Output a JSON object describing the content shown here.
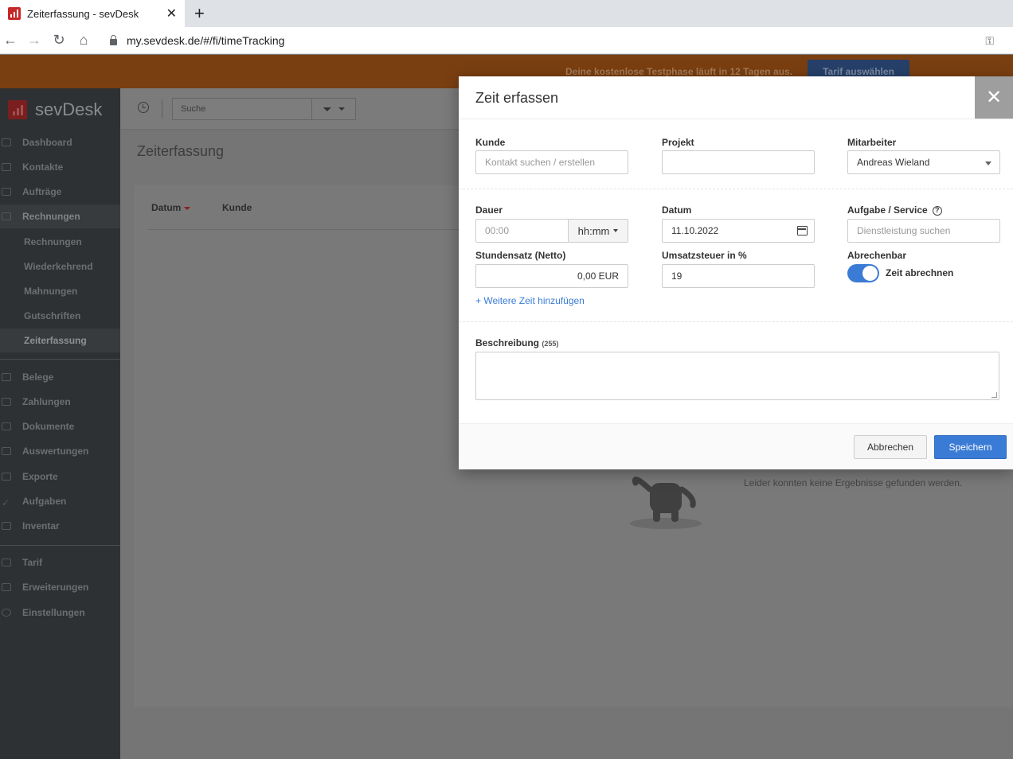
{
  "browser": {
    "tab_title": "Zeiterfassung - sevDesk",
    "tab_close": "✕",
    "new_tab": "+",
    "url": "my.sevdesk.de/#/fi/timeTracking"
  },
  "banner": {
    "text": "Deine kostenlose Testphase läuft in 12 Tagen aus.",
    "button": "Tarif auswählen"
  },
  "sidebar": {
    "logo": "sevDesk",
    "items": [
      {
        "label": "Dashboard",
        "icon": "cloud-icon"
      },
      {
        "label": "Kontakte",
        "icon": "contacts-icon"
      },
      {
        "label": "Aufträge",
        "icon": "folder-icon"
      },
      {
        "label": "Rechnungen",
        "icon": "invoice-icon"
      },
      {
        "label": "Rechnungen"
      },
      {
        "label": "Wiederkehrend"
      },
      {
        "label": "Mahnungen"
      },
      {
        "label": "Gutschriften"
      },
      {
        "label": "Zeiterfassung"
      },
      {
        "label": "Belege",
        "icon": "receipt-icon"
      },
      {
        "label": "Zahlungen",
        "icon": "payment-icon"
      },
      {
        "label": "Dokumente",
        "icon": "document-icon"
      },
      {
        "label": "Auswertungen",
        "icon": "report-icon"
      },
      {
        "label": "Exporte",
        "icon": "export-icon"
      },
      {
        "label": "Aufgaben",
        "icon": "check-icon"
      },
      {
        "label": "Inventar",
        "icon": "box-icon"
      },
      {
        "label": "Tarif",
        "icon": "chart-icon"
      },
      {
        "label": "Erweiterungen",
        "icon": "link-icon"
      },
      {
        "label": "Einstellungen",
        "icon": "gear-icon"
      }
    ]
  },
  "topbar": {
    "search_placeholder": "Suche"
  },
  "page": {
    "title": "Zeiterfassung",
    "columns": [
      "Datum",
      "Kunde"
    ],
    "empty_text": "Leider konnten keine Ergebnisse gefunden werden."
  },
  "modal": {
    "title": "Zeit erfassen",
    "close": "✕",
    "kunde": {
      "label": "Kunde",
      "placeholder": "Kontakt suchen / erstellen"
    },
    "projekt": {
      "label": "Projekt",
      "value": ""
    },
    "mitarbeiter": {
      "label": "Mitarbeiter",
      "value": "Andreas Wieland"
    },
    "dauer": {
      "label": "Dauer",
      "placeholder": "00:00",
      "unit": "hh:mm"
    },
    "datum": {
      "label": "Datum",
      "value": "11.10.2022"
    },
    "aufgabe": {
      "label": "Aufgabe / Service",
      "help": "?",
      "placeholder": "Dienstleistung suchen"
    },
    "stundensatz": {
      "label": "Stundensatz (Netto)",
      "value": "0,00 EUR"
    },
    "umsatzsteuer": {
      "label": "Umsatzsteuer in %",
      "value": "19"
    },
    "abrechenbar": {
      "label": "Abrechenbar",
      "toggle_label": "Zeit abrechnen",
      "on": true
    },
    "add_time_link": "+ Weitere Zeit hinzufügen",
    "beschreibung": {
      "label": "Beschreibung",
      "limit": "(255)"
    },
    "cancel": "Abbrechen",
    "save": "Speichern"
  },
  "colors": {
    "accent": "#3a7bd5",
    "brand": "#c62828",
    "banner": "#7a3f10",
    "sidebar": "#2e3134"
  }
}
